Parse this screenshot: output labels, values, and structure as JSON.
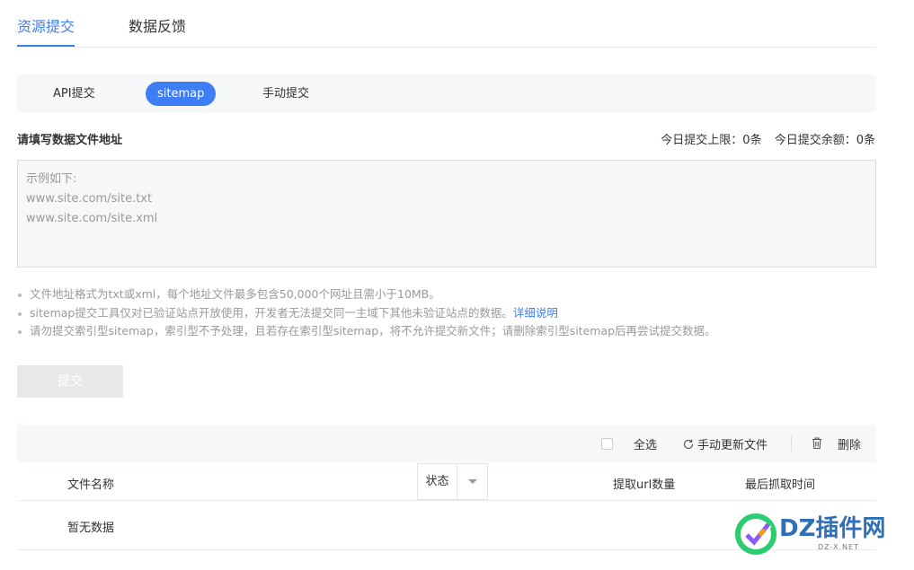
{
  "top_tabs": [
    "资源提交",
    "数据反馈"
  ],
  "sub_tabs": [
    "API提交",
    "sitemap",
    "手动提交"
  ],
  "form": {
    "label": "请填写数据文件地址",
    "quota_limit": "今日提交上限：0条",
    "quota_remaining": "今日提交余额：0条",
    "placeholder_lines": [
      "示例如下:",
      "www.site.com/site.txt",
      "www.site.com/site.xml"
    ]
  },
  "notes": {
    "line1": "文件地址格式为txt或xml，每个地址文件最多包含50,000个网址且需小于10MB。",
    "line2": "sitemap提交工具仅对已验证站点开放使用，开发者无法提交同一主域下其他未验证站点的数据。",
    "line2_link": "详细说明",
    "line3": "请勿提交索引型sitemap，索引型不予处理，且若存在索引型sitemap，将不允许提交新文件；请删除索引型sitemap后再尝试提交数据。"
  },
  "submit_label": "提交",
  "toolbar": {
    "select_all": "全选",
    "refresh": "手动更新文件",
    "delete": "删除"
  },
  "table": {
    "headers": {
      "file_name": "文件名称",
      "status": "状态",
      "url_count": "提取url数量",
      "last_crawl": "最后抓取时间"
    },
    "empty_text": "暂无数据"
  },
  "watermark": {
    "text": "DZ插件网",
    "sub": "DZ-X.NET"
  },
  "colors": {
    "accent": "#3e7ef5",
    "panel_bg": "#f6f7f9",
    "disabled_btn": "#e8e8e8"
  }
}
